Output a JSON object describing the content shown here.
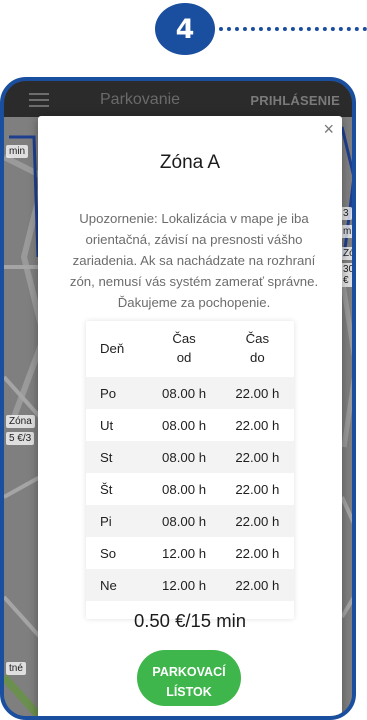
{
  "step": {
    "number": "4"
  },
  "app": {
    "title": "Parkovanie",
    "login_label": "PRIHLÁSENIE"
  },
  "map": {
    "labels": [
      "min",
      "3",
      "min",
      "Zó",
      "30 €",
      "Zóna",
      "5 €/3",
      "tné"
    ]
  },
  "modal": {
    "title": "Zóna A",
    "notice": "Upozornenie: Lokalizácia v mape je iba orientačná, závisí na presnosti vášho zariadenia. Ak sa nachádzate na rozhraní zón, nemusí vás systém zamerať správne. Ďakujeme za pochopenie.",
    "table": {
      "headers": {
        "day": "Deň",
        "from_line1": "Čas",
        "from_line2": "od",
        "to_line1": "Čas",
        "to_line2": "do"
      },
      "rows": [
        {
          "day": "Po",
          "from": "08.00 h",
          "to": "22.00 h"
        },
        {
          "day": "Ut",
          "from": "08.00 h",
          "to": "22.00 h"
        },
        {
          "day": "St",
          "from": "08.00 h",
          "to": "22.00 h"
        },
        {
          "day": "Št",
          "from": "08.00 h",
          "to": "22.00 h"
        },
        {
          "day": "Pi",
          "from": "08.00 h",
          "to": "22.00 h"
        },
        {
          "day": "So",
          "from": "12.00 h",
          "to": "22.00 h"
        },
        {
          "day": "Ne",
          "from": "12.00 h",
          "to": "22.00 h"
        }
      ]
    },
    "price": "0.50 €/15 min",
    "button_line1": "PARKOVACÍ",
    "button_line2": "LÍSTOK",
    "close_symbol": "×"
  },
  "colors": {
    "brand_blue": "#1a4e9e",
    "button_green": "#3fb64c"
  },
  "icons": {
    "menu": "hamburger-menu-icon",
    "close": "close-icon"
  }
}
